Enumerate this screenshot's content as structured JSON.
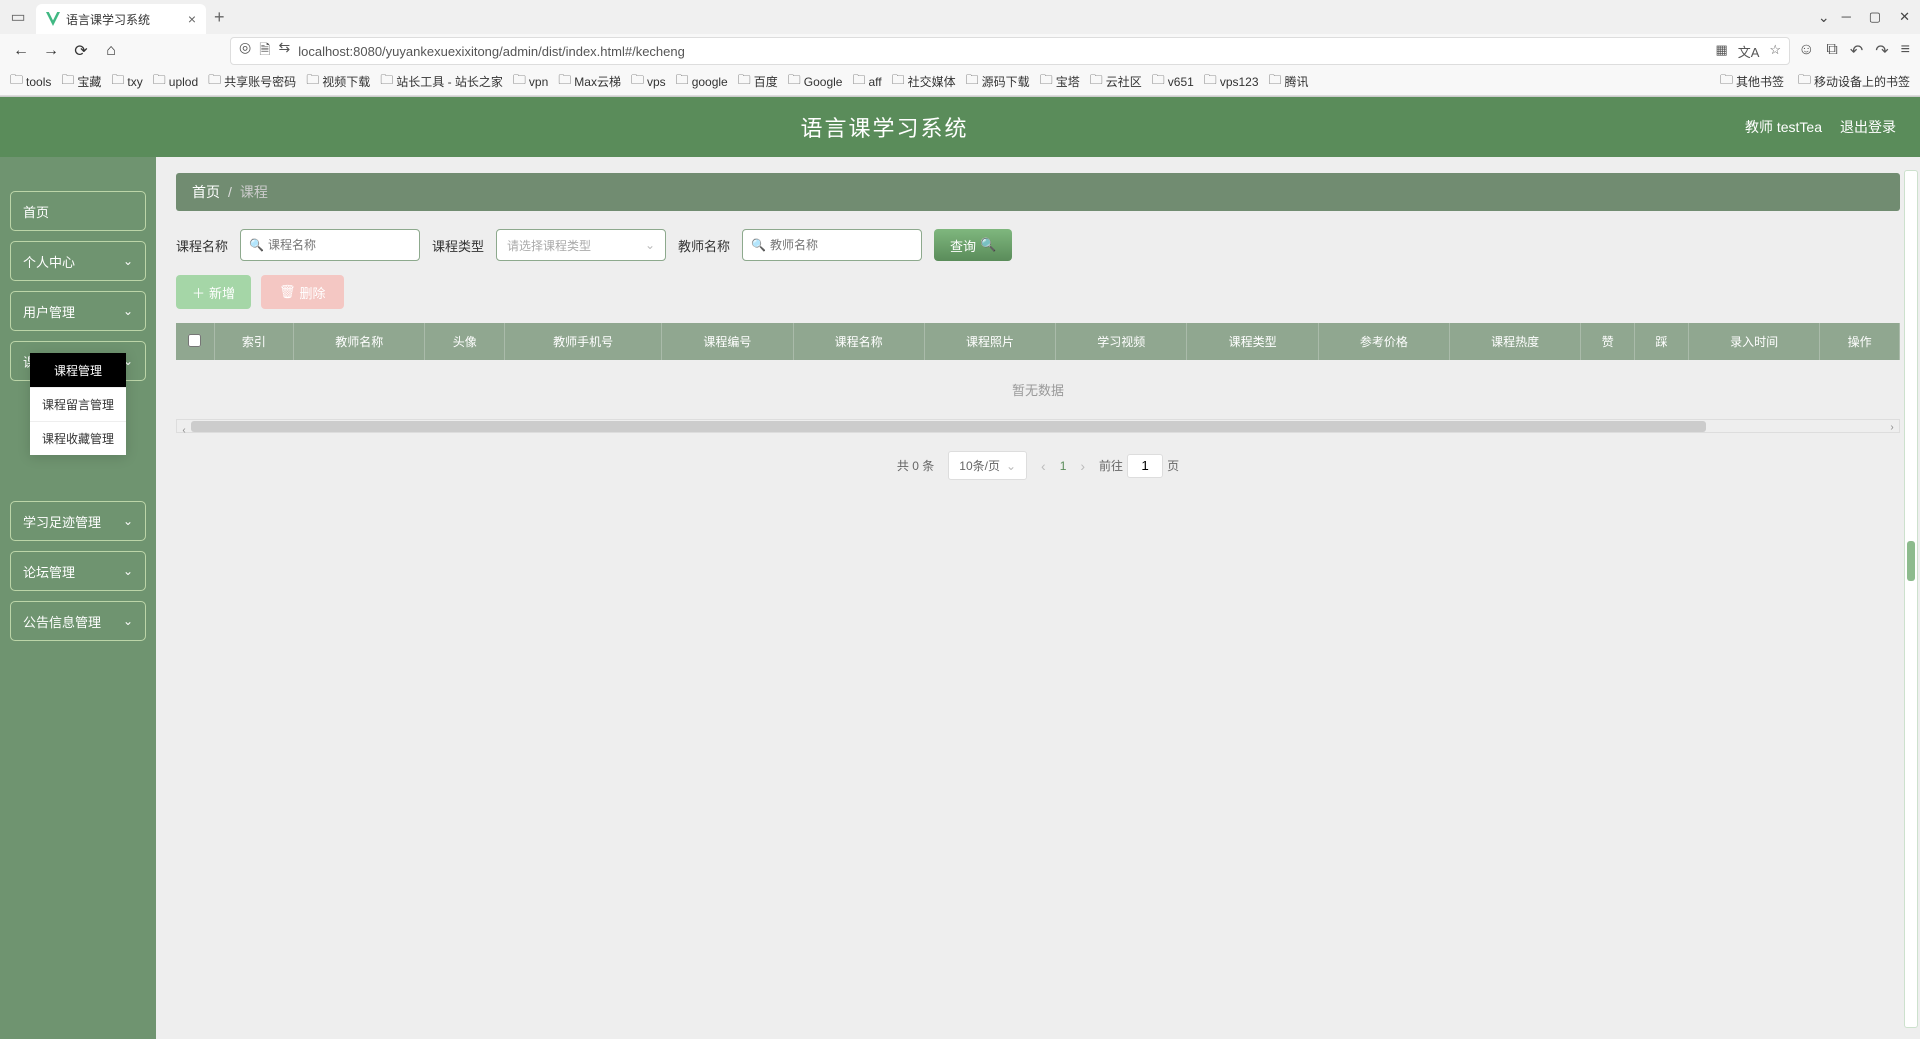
{
  "browser": {
    "tab_title": "语言课学习系统",
    "url": "localhost:8080/yuyankexuexixitong/admin/dist/index.html#/kecheng",
    "bookmarks_left": [
      "tools",
      "宝藏",
      "txy",
      "uplod",
      "共享账号密码",
      "视频下载",
      "站长工具 - 站长之家",
      "vpn",
      "Max云梯",
      "vps",
      "google",
      "百度",
      "Google",
      "aff",
      "社交媒体",
      "源码下载",
      "宝塔",
      "云社区",
      "v651",
      "vps123",
      "腾讯"
    ],
    "bookmarks_right": [
      "其他书签",
      "移动设备上的书签"
    ]
  },
  "header": {
    "logo": "语言课学习系统",
    "user_label": "教师 testTea",
    "logout": "退出登录"
  },
  "sidebar": {
    "items": [
      "首页",
      "个人中心",
      "用户管理",
      "课程管理",
      "学习足迹管理",
      "论坛管理",
      "公告信息管理"
    ],
    "submenu": [
      "课程管理",
      "课程留言管理",
      "课程收藏管理"
    ]
  },
  "breadcrumb": {
    "home": "首页",
    "sep": "/",
    "current": "课程"
  },
  "filters": {
    "name_label": "课程名称",
    "name_ph": "课程名称",
    "type_label": "课程类型",
    "type_ph": "请选择课程类型",
    "teacher_label": "教师名称",
    "teacher_ph": "教师名称",
    "search_btn": "查询"
  },
  "actions": {
    "add": "新增",
    "del": "删除"
  },
  "table": {
    "columns": [
      "",
      "索引",
      "教师名称",
      "头像",
      "教师手机号",
      "课程编号",
      "课程名称",
      "课程照片",
      "学习视频",
      "课程类型",
      "参考价格",
      "课程热度",
      "赞",
      "踩",
      "录入时间",
      "操作"
    ],
    "no_data": "暂无数据"
  },
  "pagination": {
    "total": "共 0 条",
    "page_size": "10条/页",
    "current": "1",
    "jump_prefix": "前往",
    "jump_value": "1",
    "jump_suffix": "页"
  }
}
